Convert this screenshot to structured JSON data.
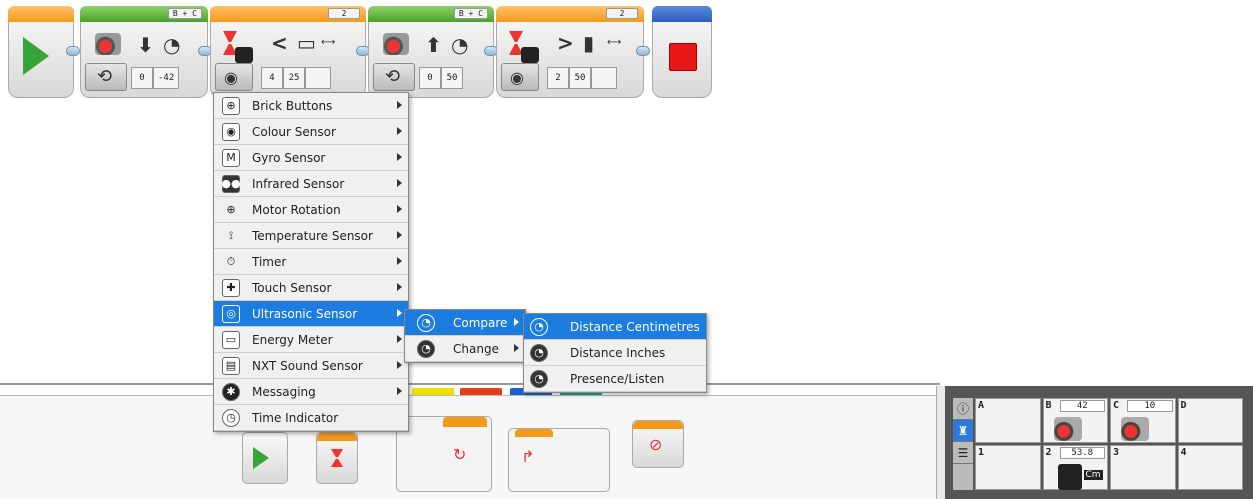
{
  "program": {
    "start_block": {
      "icon": "play-icon"
    },
    "move_block_1": {
      "ports": "B + C",
      "steering": "0",
      "power": "-42",
      "mode": "steering-mode"
    },
    "wait_block_1": {
      "count": "2",
      "comparison": "<",
      "threshold": "4",
      "value": "25",
      "unit": "cm"
    },
    "move_block_2": {
      "ports": "B + C",
      "steering": "0",
      "power": "50",
      "mode": "steering-mode"
    },
    "wait_block_2": {
      "count": "2",
      "comparison": ">",
      "threshold": "2",
      "value": "50",
      "unit": "cm"
    },
    "stop_block": {
      "icon": "stop-icon"
    }
  },
  "sensor_menu": {
    "items": [
      {
        "label": "Brick Buttons",
        "icon": "brick-buttons-icon"
      },
      {
        "label": "Colour Sensor",
        "icon": "colour-sensor-icon"
      },
      {
        "label": "Gyro Sensor",
        "icon": "gyro-sensor-icon"
      },
      {
        "label": "Infrared Sensor",
        "icon": "infrared-sensor-icon"
      },
      {
        "label": "Motor Rotation",
        "icon": "motor-rotation-icon"
      },
      {
        "label": "Temperature Sensor",
        "icon": "temperature-sensor-icon"
      },
      {
        "label": "Timer",
        "icon": "timer-icon"
      },
      {
        "label": "Touch Sensor",
        "icon": "touch-sensor-icon"
      },
      {
        "label": "Ultrasonic Sensor",
        "icon": "ultrasonic-sensor-icon"
      },
      {
        "label": "Energy Meter",
        "icon": "energy-meter-icon"
      },
      {
        "label": "NXT Sound Sensor",
        "icon": "nxt-sound-sensor-icon"
      },
      {
        "label": "Messaging",
        "icon": "messaging-icon"
      },
      {
        "label": "Time Indicator",
        "icon": "time-indicator-icon"
      }
    ],
    "selected_index": 8
  },
  "compare_menu": {
    "items": [
      {
        "label": "Compare",
        "icon": "compare-icon"
      },
      {
        "label": "Change",
        "icon": "change-icon"
      }
    ],
    "selected_index": 0
  },
  "distance_menu": {
    "items": [
      {
        "label": "Distance Centimetres",
        "icon": "distance-cm-icon"
      },
      {
        "label": "Distance Inches",
        "icon": "distance-inches-icon"
      },
      {
        "label": "Presence/Listen",
        "icon": "presence-listen-icon"
      }
    ],
    "selected_index": 0
  },
  "palette": {
    "tab_colors": [
      "#f0e000",
      "#e0401a",
      "#1d5fd0",
      "#1aa39a"
    ]
  },
  "port_view": {
    "motor_ports": [
      {
        "port": "A",
        "value": ""
      },
      {
        "port": "B",
        "value": "42"
      },
      {
        "port": "C",
        "value": "10"
      },
      {
        "port": "D",
        "value": ""
      }
    ],
    "sensor_ports": [
      {
        "port": "1",
        "value": ""
      },
      {
        "port": "2",
        "value": "53.8",
        "unit": "Cm"
      },
      {
        "port": "3",
        "value": ""
      },
      {
        "port": "4",
        "value": ""
      }
    ]
  },
  "colors": {
    "accent": "#1c7ce0",
    "start": "#38a437",
    "stop": "#e81818",
    "move": "#4aa22c",
    "wait": "#f39a1b"
  }
}
